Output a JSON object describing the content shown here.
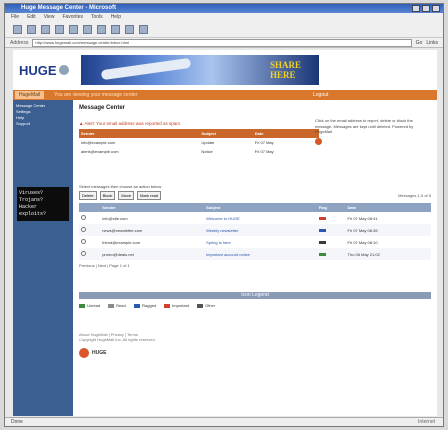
{
  "window": {
    "title": "Huge Message Center - Microsoft"
  },
  "menubar": [
    "File",
    "Edit",
    "View",
    "Favorites",
    "Tools",
    "Help"
  ],
  "address": {
    "label": "Address",
    "url": "http://www.hugemail.com/message-center/inbox.html",
    "go": "Go",
    "links": "Links"
  },
  "banner": {
    "logo": "HUGE",
    "ad_text_line1": "SHARE",
    "ad_text_line2": "HERE"
  },
  "navbar": {
    "home": "HugeMail",
    "crumb": "You are viewing your message center",
    "logout": "Logout"
  },
  "sidebar": {
    "items": [
      "Message Center",
      "Settings",
      "Help",
      "Support"
    ],
    "ad_lines": [
      "Viruses?",
      "Trojans?",
      "Hacker",
      "exploits?"
    ]
  },
  "content": {
    "title": "Message Center",
    "warning": "Alert: Your email address was reported as spam",
    "mini_headers": [
      "Sender",
      "Subject",
      "Date"
    ],
    "mini_rows": [
      [
        "info@example.com",
        "Update",
        "Fri 07 May"
      ],
      [
        "alerts@example.com",
        "Notice",
        "Fri 07 May"
      ]
    ],
    "right_note": "Click on the email address to report, delete or block the message. Messages are kept until deleted. Powered by HugeMail."
  },
  "toolbar_actions": {
    "label": "Select messages then choose an action below",
    "buttons": [
      "Delete",
      "Block",
      "Move",
      "Mark read"
    ],
    "count": "Messages 1-5 of 5"
  },
  "table": {
    "headers": [
      "",
      "Sender",
      "Subject",
      "Flag",
      "Date"
    ],
    "rows": [
      {
        "sender": "info@site.com",
        "subject": "Welcome to HUGE",
        "date": "Fri 07 May 08:41",
        "color": "#d04030"
      },
      {
        "sender": "news@newsletter.com",
        "subject": "Weekly newsletter",
        "date": "Fri 07 May 08:35",
        "color": "#2a58b0"
      },
      {
        "sender": "friend@example.com",
        "subject": "Spring is here",
        "date": "Fri 07 May 08:10",
        "color": "#3a3a3a"
      },
      {
        "sender": "promo@deals.net",
        "subject": "Important account notice",
        "date": "Thu 06 May 21:02",
        "color": "#3d8a3a"
      }
    ]
  },
  "pager": "Previous | Next | Page 1 of 1",
  "legend": {
    "title": "Icon Legend",
    "items": [
      {
        "label": "Unread",
        "color": "#3d8a3a"
      },
      {
        "label": "Read",
        "color": "#8a8a8a"
      },
      {
        "label": "Flagged",
        "color": "#2a58b0"
      },
      {
        "label": "Important",
        "color": "#d04030"
      },
      {
        "label": "Other",
        "color": "#555555"
      }
    ]
  },
  "footer": {
    "lines": [
      "About HugeMail | Privacy | Terms",
      "Copyright HugeMail Inc. All rights reserved."
    ],
    "brand": "HUGE"
  },
  "status": {
    "left": "Done",
    "right": "Internet"
  }
}
